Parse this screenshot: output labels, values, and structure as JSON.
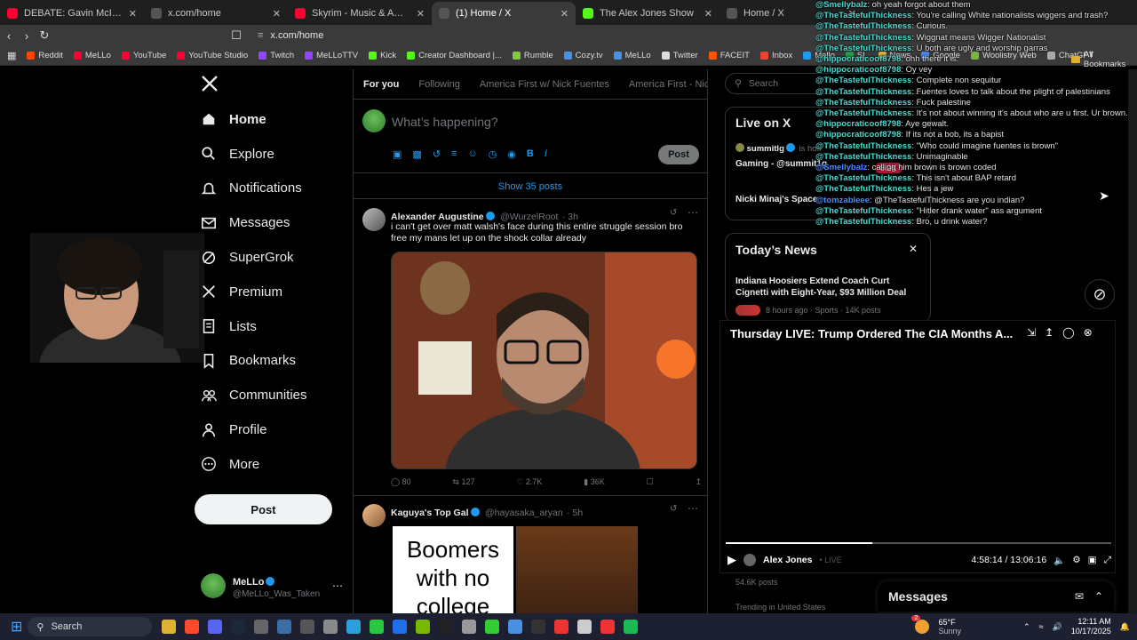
{
  "browser": {
    "tabs": [
      {
        "label": "DEBATE: Gavin McInnes VS Nick Fue",
        "color": "#ff0033",
        "active": false
      },
      {
        "label": "x.com/home",
        "color": "#555555",
        "active": false
      },
      {
        "label": "Skyrim - Music & Ambience - Rainy",
        "color": "#ff0033",
        "active": false
      },
      {
        "label": "(1) Home / X",
        "color": "#555555",
        "active": true
      },
      {
        "label": "The Alex Jones Show",
        "color": "#53fc18",
        "active": false
      },
      {
        "label": "Home / X",
        "color": "#555555",
        "active": false
      }
    ],
    "url": "x.com/home",
    "bookmarks": [
      {
        "label": "Reddit",
        "color": "#ff4500"
      },
      {
        "label": "MeLLo",
        "color": "#ff0033"
      },
      {
        "label": "YouTube",
        "color": "#ff0033"
      },
      {
        "label": "YouTube Studio",
        "color": "#ff0033"
      },
      {
        "label": "Twitch",
        "color": "#9146ff"
      },
      {
        "label": "MeLLoTTV",
        "color": "#9146ff"
      },
      {
        "label": "Kick",
        "color": "#53fc18"
      },
      {
        "label": "Creator Dashboard |...",
        "color": "#53fc18"
      },
      {
        "label": "Rumble",
        "color": "#85c742"
      },
      {
        "label": "Cozy.tv",
        "color": "#4a90e2"
      },
      {
        "label": "MeLLo",
        "color": "#4a90e2"
      },
      {
        "label": "Twitter",
        "color": "#dddddd"
      },
      {
        "label": "FACEIT",
        "color": "#ff5500"
      },
      {
        "label": "Inbox",
        "color": "#ea4335"
      },
      {
        "label": "Mello",
        "color": "#1d9bf0"
      },
      {
        "label": "SL",
        "color": "#2a9d4a"
      },
      {
        "label": "News",
        "color": "#e0b030"
      },
      {
        "label": "Google",
        "color": "#4285f4"
      },
      {
        "label": "Woolistry Web",
        "color": "#7cb342"
      },
      {
        "label": "ChatGPT",
        "color": "#aaaaaa"
      }
    ],
    "all_bookmarks": "All Bookmarks"
  },
  "nav": {
    "items": [
      {
        "label": "Home",
        "icon": "home-icon"
      },
      {
        "label": "Explore",
        "icon": "search-icon"
      },
      {
        "label": "Notifications",
        "icon": "bell-icon"
      },
      {
        "label": "Messages",
        "icon": "envelope-icon"
      },
      {
        "label": "SuperGrok",
        "icon": "grok-icon"
      },
      {
        "label": "Premium",
        "icon": "x-logo-icon"
      },
      {
        "label": "Lists",
        "icon": "list-icon"
      },
      {
        "label": "Bookmarks",
        "icon": "bookmark-icon"
      },
      {
        "label": "Communities",
        "icon": "communities-icon"
      },
      {
        "label": "Profile",
        "icon": "person-icon"
      },
      {
        "label": "More",
        "icon": "more-circle-icon"
      }
    ],
    "post_label": "Post",
    "account_name": "MeLLo",
    "account_handle": "@MeLLo_Was_Taken"
  },
  "feed": {
    "tabs": [
      "For you",
      "Following",
      "America First w/ Nick Fuentes",
      "America First - Nick Fu"
    ],
    "compose_placeholder": "What’s happening?",
    "compose_post": "Post",
    "show_posts": "Show 35 posts",
    "tweets": [
      {
        "name": "Alexander Augustine",
        "handle": "@WurzelRoot",
        "time": "· 3h",
        "text": "i can't get over matt walsh's face during this entire struggle session bro free my mans let up on the shock collar already",
        "replies": "80",
        "reposts": "127",
        "likes": "2.7K",
        "views": "36K"
      },
      {
        "name": "Kaguya's Top Gal",
        "handle": "@hayasaka_aryan",
        "time": "· 5h",
        "meme_text": "Boomers with no college"
      }
    ]
  },
  "right": {
    "search_placeholder": "Search",
    "live_title": "Live on X",
    "live_items": [
      {
        "host": "summitlg",
        "suffix": "is hos",
        "title": "Gaming - @summit1g"
      },
      {
        "host": "",
        "suffix": "",
        "title": "Nicki Minaj's Space"
      }
    ],
    "live_count": "5.2K",
    "news_title": "Today’s News",
    "news_headline": "Indiana Hoosiers Extend Coach Curt Cignetti with Eight-Year, $93 Million Deal",
    "news_meta": "8 hours ago · Sports · 14K posts",
    "trend_posts": "54.6K posts",
    "trend_meta": "Trending in United States"
  },
  "chat": [
    {
      "user": "@Smellybalz",
      "text": ": oh yeah forgot about them",
      "blue": false
    },
    {
      "user": "@TheTastefulThickness",
      "text": ": You're calling White nationalists wiggers and trash?",
      "blue": false
    },
    {
      "user": "@TheTastefulThickness",
      "text": ": Curious.",
      "blue": false
    },
    {
      "user": "@TheTastefulThickness",
      "text": ": Wiggnat means Wigger Nationalist",
      "blue": false
    },
    {
      "user": "@TheTastefulThickness",
      "text": ": U both are ugly and worship garras",
      "blue": false
    },
    {
      "user": "@hippocraticoof8798",
      "text": ": ohh there it is.",
      "blue": false
    },
    {
      "user": "@hippocraticoof8798",
      "text": ": Oy vey",
      "blue": false
    },
    {
      "user": "@TheTastefulThickness",
      "text": ": Complete non sequitur",
      "blue": false
    },
    {
      "user": "@TheTastefulThickness",
      "text": ": Fuentes loves to talk about the plight of palestinians",
      "blue": false
    },
    {
      "user": "@TheTastefulThickness",
      "text": ": Fuck palestine",
      "blue": false
    },
    {
      "user": "@TheTastefulThickness",
      "text": ": It's not about winning it's about who are u first. Ur brown. It's not about u",
      "blue": false
    },
    {
      "user": "@hippocraticoof8798",
      "text": ": Aye gewalt.",
      "blue": false
    },
    {
      "user": "@hippocraticoof8798",
      "text": ": If its not a bob, its a bapist",
      "blue": false
    },
    {
      "user": "@TheTastefulThickness",
      "text": ": \"Who could imagine fuentes is brown\"",
      "blue": false
    },
    {
      "user": "@TheTastefulThickness",
      "text": ": Unimaginable",
      "blue": false
    },
    {
      "user": "@Smellybalz",
      "text": ": calling him brown is brown coded",
      "blue": true
    },
    {
      "user": "@TheTastefulThickness",
      "text": ": This isn't about BAP retard",
      "blue": false
    },
    {
      "user": "@TheTastefulThickness",
      "text": ": Hes a jew",
      "blue": false
    },
    {
      "user": "@tomzableee",
      "text": ": @TheTastefulThickness are you indian?",
      "blue": true
    },
    {
      "user": "@TheTastefulThickness",
      "text": ": \"Hitler drank water\" ass argument",
      "blue": false
    },
    {
      "user": "@TheTastefulThickness",
      "text": ": Bro, u drink water?",
      "blue": false
    }
  ],
  "video": {
    "title": "Thursday LIVE: Trump Ordered The CIA Months A...",
    "channel": "Alex Jones",
    "live_label": "• LIVE",
    "time": "4:58:14 / 13:06:16",
    "progress": 0.38
  },
  "messages_label": "Messages",
  "taskbar": {
    "search": "Search",
    "weather_temp": "65°F",
    "weather_desc": "Sunny",
    "time": "12:11 AM",
    "date": "10/17/2025",
    "badge": "2"
  },
  "colors": {
    "accent": "#1d9bf0",
    "chat_user": "#4ed9d0",
    "background": "#000000"
  }
}
